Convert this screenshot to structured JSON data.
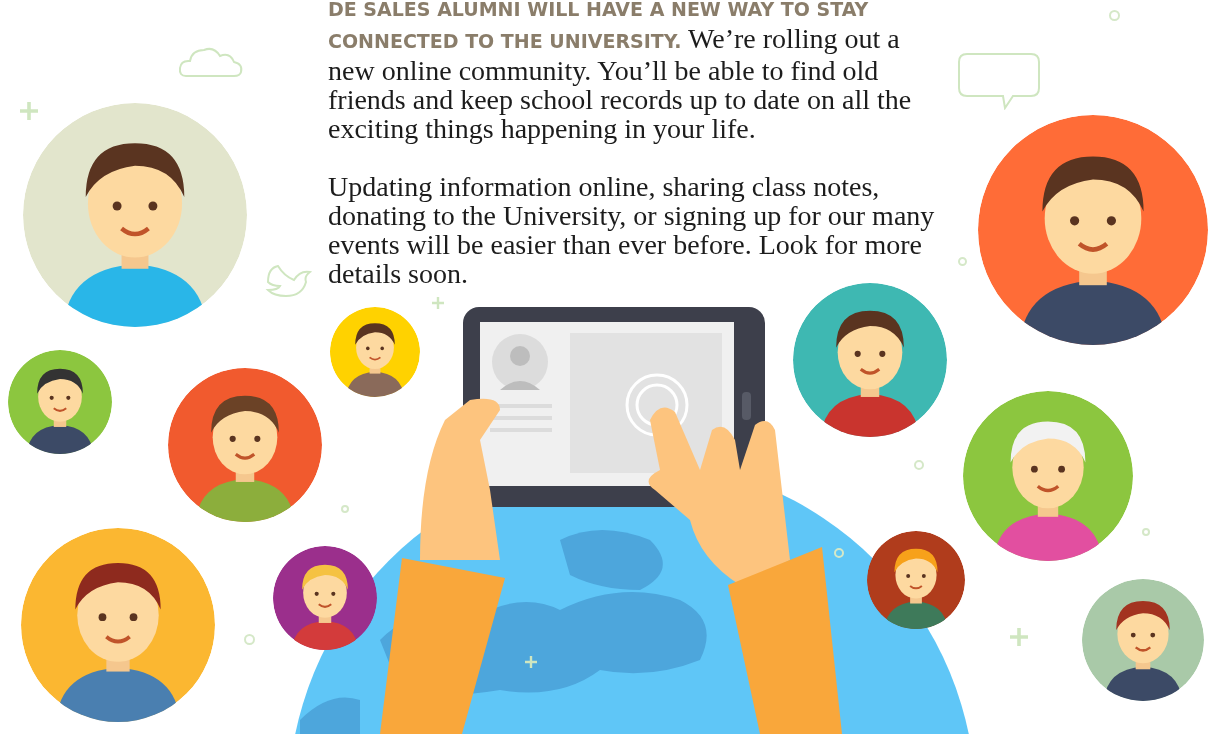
{
  "intro": {
    "lead": "DE SALES ALUMNI WILL HAVE A NEW WAY TO STAY CONNECTED TO THE UNIVERSITY.",
    "text": "We’re rolling out a new online community. You’ll be able to find old friends and keep school records up to date on all the exciting things happening in your life."
  },
  "details": {
    "text": "Updating information online, sharing class notes, donating to the University, or signing up for our many events will be easier than ever before. Look for more details soon."
  }
}
